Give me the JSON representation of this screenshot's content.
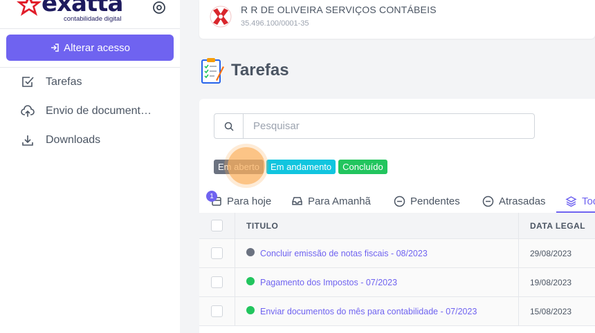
{
  "brand": {
    "name": "exatta",
    "tagline": "contabilidade digital",
    "accent": "#6f63f0",
    "logo_red": "#e11d2a"
  },
  "sidebar": {
    "alter_button": "Alterar acesso",
    "items": [
      {
        "label": "Tarefas",
        "icon": "check-square-icon"
      },
      {
        "label": "Envio de document…",
        "icon": "cloud-upload-icon"
      },
      {
        "label": "Downloads",
        "icon": "download-icon"
      }
    ]
  },
  "company": {
    "name": "R R DE OLIVEIRA SERVIÇOS CONTÁBEIS",
    "cnpj": "35.496.100/0001-35"
  },
  "page": {
    "title": "Tarefas"
  },
  "search": {
    "placeholder": "Pesquisar",
    "value": ""
  },
  "filters": [
    {
      "label": "Em aberto",
      "color": "#6b7280"
    },
    {
      "label": "Em andamento",
      "color": "#11c5df"
    },
    {
      "label": "Concluído",
      "color": "#22c55e"
    }
  ],
  "tabs": [
    {
      "label": "Para hoje",
      "icon": "calendar-icon",
      "badge": "1"
    },
    {
      "label": "Para Amanhã",
      "icon": "inbox-icon"
    },
    {
      "label": "Pendentes",
      "icon": "minus-circle-icon"
    },
    {
      "label": "Atrasadas",
      "icon": "minus-circle-icon"
    },
    {
      "label": "Todas",
      "icon": "layers-icon",
      "active": true
    }
  ],
  "table": {
    "headers": {
      "title": "TITULO",
      "date": "DATA LEGAL"
    },
    "rows": [
      {
        "title": "Concluir emissão de notas fiscais - 08/2023",
        "date": "29/08/2023",
        "status_color": "#6b7280"
      },
      {
        "title": "Pagamento dos Impostos - 07/2023",
        "date": "19/08/2023",
        "status_color": "#22c55e"
      },
      {
        "title": "Enviar documentos do mês para contabilidade - 07/2023",
        "date": "15/08/2023",
        "status_color": "#22c55e"
      }
    ]
  }
}
